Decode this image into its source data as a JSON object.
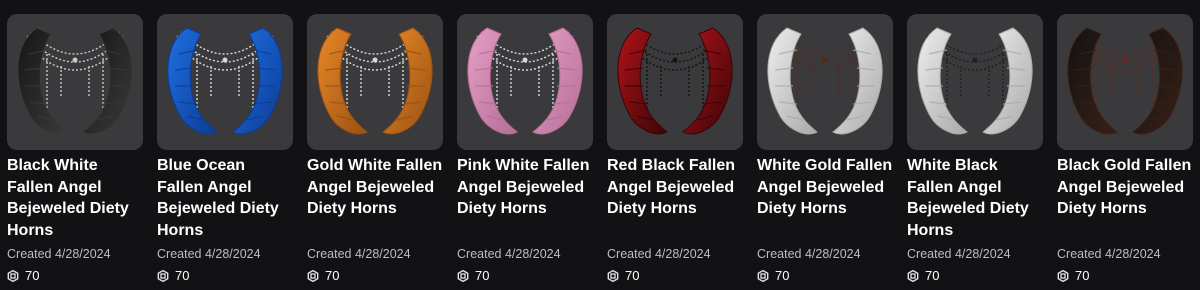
{
  "items": [
    {
      "name": "Black White Fallen Angel Bejeweled Diety Horns",
      "created": "Created 4/28/2024",
      "price": "70",
      "icon": "horns-black-white-thumbnail",
      "horn_color": "#161616",
      "horn_shade": "#3a3a3a",
      "chain_color": "#c9c9c9"
    },
    {
      "name": "Blue Ocean Fallen Angel Bejeweled Diety Horns",
      "created": "Created 4/28/2024",
      "price": "70",
      "icon": "horns-blue-ocean-thumbnail",
      "horn_color": "#1f6fe0",
      "horn_shade": "#0b3c96",
      "chain_color": "#d6d8dc"
    },
    {
      "name": "Gold White Fallen Angel Bejeweled Diety Horns",
      "created": "Created 4/28/2024",
      "price": "70",
      "icon": "horns-gold-white-thumbnail",
      "horn_color": "#e8892a",
      "horn_shade": "#9a5010",
      "chain_color": "#d6d8dc"
    },
    {
      "name": "Pink White Fallen Angel Bejeweled Diety Horns",
      "created": "Created 4/28/2024",
      "price": "70",
      "icon": "horns-pink-white-thumbnail",
      "horn_color": "#e6a0c8",
      "horn_shade": "#b46e96",
      "chain_color": "#d6d8dc"
    },
    {
      "name": "Red Black Fallen Angel Bejeweled Diety Horns",
      "created": "Created 4/28/2024",
      "price": "70",
      "icon": "horns-red-black-thumbnail",
      "horn_color": "#b0141a",
      "horn_shade": "#3a0406",
      "chain_color": "#141414"
    },
    {
      "name": "White Gold Fallen Angel Bejeweled Diety Horns",
      "created": "Created 4/28/2024",
      "price": "70",
      "icon": "horns-white-gold-thumbnail",
      "horn_color": "#eeeeee",
      "horn_shade": "#a9a9a9",
      "chain_color": "#5a2618"
    },
    {
      "name": "White Black Fallen Angel Bejeweled Diety Horns",
      "created": "Created 4/28/2024",
      "price": "70",
      "icon": "horns-white-black-thumbnail",
      "horn_color": "#eeeeee",
      "horn_shade": "#a9a9a9",
      "chain_color": "#202020"
    },
    {
      "name": "Black Gold Fallen Angel Bejeweled Diety Horns",
      "created": "Created 4/28/2024",
      "price": "70",
      "icon": "horns-black-gold-thumbnail",
      "horn_color": "#121212",
      "horn_shade": "#3a2018",
      "chain_color": "#6a2a18"
    }
  ],
  "currency_icon": "robux-icon"
}
